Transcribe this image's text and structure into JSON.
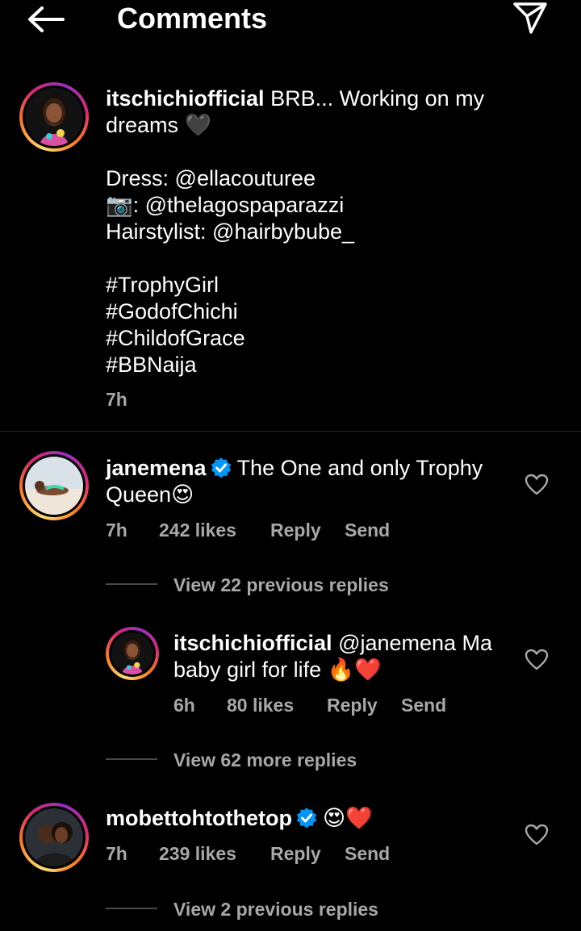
{
  "header": {
    "title": "Comments"
  },
  "caption": {
    "username": "itschichiofficial",
    "text_line1": "BRB... Working on my",
    "text_line2": "dreams",
    "line2_emoji": "🖤",
    "dress_label": "Dress:",
    "dress_handle": "@ellacouturee",
    "camera_emoji": "📷",
    "camera_handle": "@thelagospaparazzi",
    "hair_label": "Hairstylist:",
    "hair_handle": "@hairbybube_",
    "hashtags": [
      "#TrophyGirl",
      "#GodofChichi",
      "#ChildofGrace",
      "#BBNaija"
    ],
    "time": "7h"
  },
  "comments": [
    {
      "username": "janemena",
      "verified": true,
      "text_line1": "The One and only Trophy",
      "text_line2": "Queen",
      "text_emoji": "😍",
      "time": "7h",
      "likes": "242 likes",
      "reply": "Reply",
      "send": "Send",
      "view_replies": "View 22 previous replies",
      "reply_item": {
        "username": "itschichiofficial",
        "text_line1": "@janemena Ma",
        "text_line2": "baby girl for life",
        "text_emoji": "🔥❤️",
        "time": "6h",
        "likes": "80 likes",
        "reply": "Reply",
        "send": "Send"
      },
      "more_replies": "View 62 more replies"
    },
    {
      "username": "mobettohtothetop",
      "verified": true,
      "text_emoji": "😍❤️",
      "time": "7h",
      "likes": "239 likes",
      "reply": "Reply",
      "send": "Send",
      "view_replies": "View 2 previous replies"
    }
  ],
  "colors": {
    "background": "#000000",
    "muted": "#a8a8a8",
    "verified": "#0095f6",
    "divider": "#262626"
  },
  "icons": [
    "back-arrow-icon",
    "send-icon",
    "heart-icon",
    "verified-badge-icon"
  ]
}
